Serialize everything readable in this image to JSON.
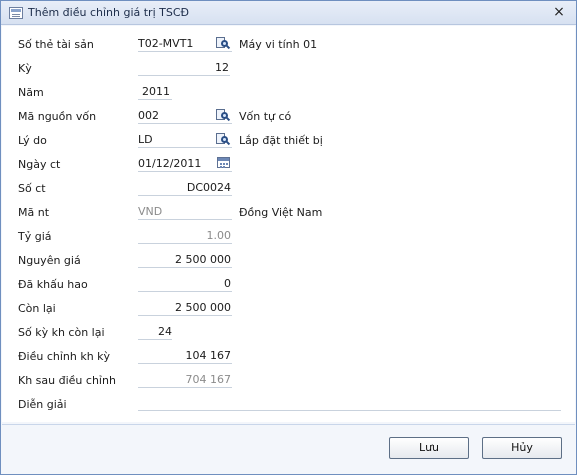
{
  "window": {
    "title": "Thêm điều chỉnh giá trị TSCĐ",
    "close_symbol": "×"
  },
  "form": {
    "asset_code": {
      "label": "Số thẻ tài sản",
      "value": "T02-MVT1",
      "description": "Máy vi tính 01"
    },
    "period": {
      "label": "Kỳ",
      "value": "12"
    },
    "year": {
      "label": "Năm",
      "value": "2011"
    },
    "fund_source": {
      "label": "Mã nguồn vốn",
      "value": "002",
      "description": "Vốn tự có"
    },
    "reason": {
      "label": "Lý do",
      "value": "LD",
      "description": "Lắp đặt thiết bị"
    },
    "doc_date": {
      "label": "Ngày ct",
      "value": "01/12/2011"
    },
    "doc_number": {
      "label": "Số ct",
      "value": "DC0024"
    },
    "currency": {
      "label": "Mã nt",
      "value": "VND",
      "description": "Đồng Việt Nam"
    },
    "exchange_rate": {
      "label": "Tỷ giá",
      "value": "1.00"
    },
    "original_cost": {
      "label": "Nguyên giá",
      "value": "2 500 000"
    },
    "depreciated": {
      "label": "Đã khấu hao",
      "value": "0"
    },
    "remaining": {
      "label": "Còn lại",
      "value": "2 500 000"
    },
    "remaining_periods": {
      "label": "Số kỳ kh còn lại",
      "value": "24"
    },
    "period_adjustment": {
      "label": "Điều chỉnh kh kỳ",
      "value": "104 167"
    },
    "after_adjustment": {
      "label": "Kh sau điều chỉnh",
      "value": "704 167"
    },
    "explanation": {
      "label": "Diễn giải",
      "value": ""
    }
  },
  "buttons": {
    "save": "Lưu",
    "cancel": "Hủy"
  },
  "icons": {
    "lookup": "lookup-icon",
    "calendar": "calendar-icon",
    "window": "form-icon"
  }
}
